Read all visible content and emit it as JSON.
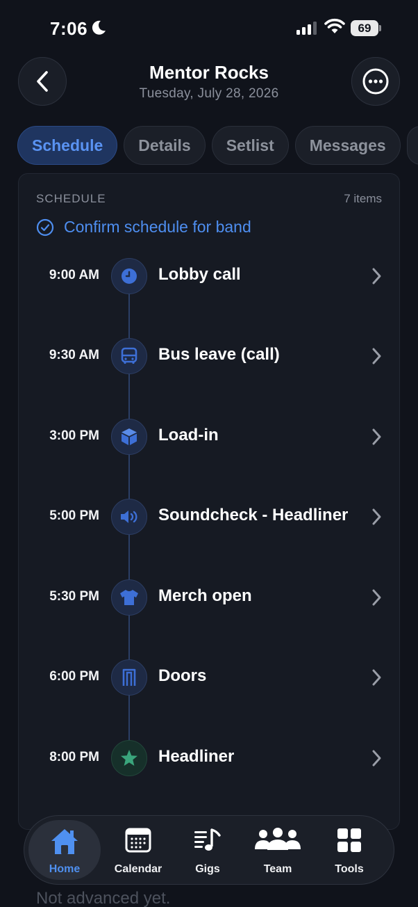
{
  "status_bar": {
    "time": "7:06",
    "battery": "69"
  },
  "header": {
    "title": "Mentor Rocks",
    "subtitle": "Tuesday, July 28, 2026"
  },
  "tabs": [
    {
      "label": "Schedule",
      "active": true
    },
    {
      "label": "Details",
      "active": false
    },
    {
      "label": "Setlist",
      "active": false
    },
    {
      "label": "Messages",
      "active": false
    }
  ],
  "schedule": {
    "section_label": "SCHEDULE",
    "count": "7 items",
    "confirm_label": "Confirm schedule for band",
    "items": [
      {
        "time": "9:00 AM",
        "title": "Lobby call",
        "icon": "clock-icon"
      },
      {
        "time": "9:30 AM",
        "title": "Bus leave (call)",
        "icon": "bus-icon"
      },
      {
        "time": "3:00 PM",
        "title": "Load-in",
        "icon": "box-icon"
      },
      {
        "time": "5:00 PM",
        "title": "Soundcheck - Headliner",
        "icon": "speaker-icon"
      },
      {
        "time": "5:30 PM",
        "title": "Merch open",
        "icon": "tshirt-icon"
      },
      {
        "time": "6:00 PM",
        "title": "Doors",
        "icon": "door-icon"
      },
      {
        "time": "8:00 PM",
        "title": "Headliner",
        "icon": "star-icon"
      }
    ]
  },
  "footer_text": "Not advanced yet.",
  "nav": [
    {
      "label": "Home",
      "icon": "home-icon",
      "active": true
    },
    {
      "label": "Calendar",
      "icon": "calendar-icon",
      "active": false
    },
    {
      "label": "Gigs",
      "icon": "music-list-icon",
      "active": false
    },
    {
      "label": "Team",
      "icon": "team-icon",
      "active": false
    },
    {
      "label": "Tools",
      "icon": "grid-icon",
      "active": false
    }
  ],
  "colors": {
    "background": "#10131b",
    "accent": "#4e8ef0",
    "node_blue": "#3d6fd6",
    "node_green": "#3aa57c"
  }
}
